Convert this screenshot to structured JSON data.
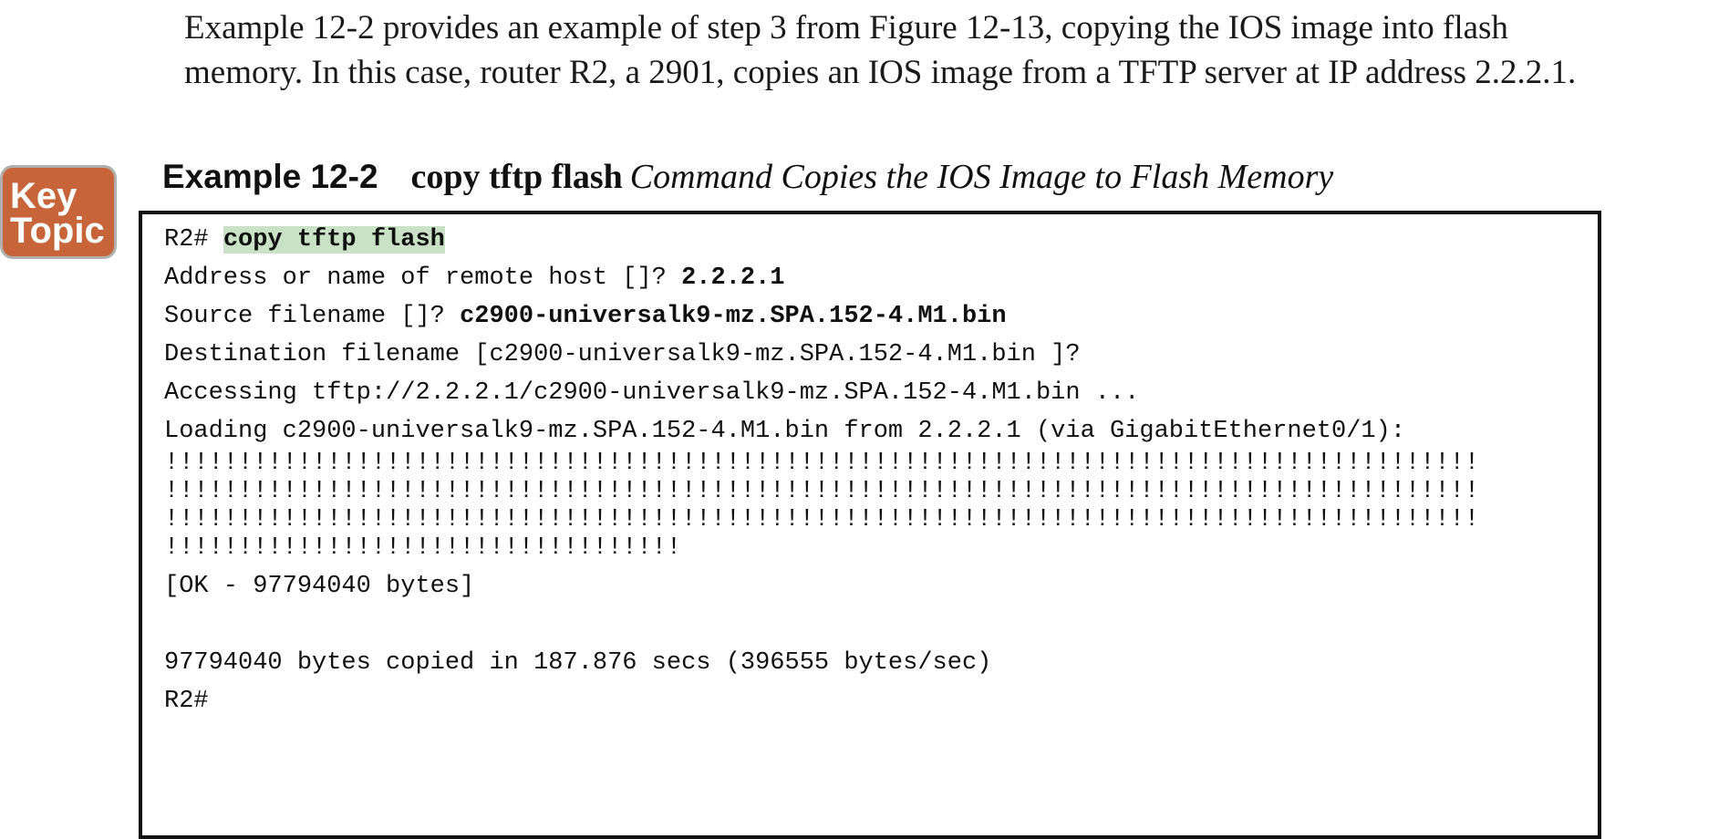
{
  "intro": {
    "text": "Example 12-2 provides an example of step 3 from Figure 12-13, copying the IOS image into flash memory. In this case, router R2, a 2901, copies an IOS image from a TFTP server at IP address 2.2.2.1."
  },
  "key_topic": {
    "line1": "Key",
    "line2": "Topic",
    "color": "#c8643a"
  },
  "example": {
    "label": "Example 12-2",
    "command": "copy tftp flash",
    "description": "Command Copies the IOS Image to Flash Memory"
  },
  "terminal": {
    "line1_prompt": "R2# ",
    "line1_cmd": "copy tftp flash",
    "line2_prompt": "Address or name of remote host []? ",
    "line2_value": "2.2.2.1",
    "line3_prompt": "Source filename []? ",
    "line3_value": "c2900-universalk9-mz.SPA.152-4.M1.bin",
    "line4": "Destination filename [c2900-universalk9-mz.SPA.152-4.M1.bin ]?",
    "line5": "Accessing tftp://2.2.2.1/c2900-universalk9-mz.SPA.152-4.M1.bin ...",
    "line6": "Loading c2900-universalk9-mz.SPA.152-4.M1.bin from 2.2.2.1 (via GigabitEthernet0/1):",
    "bang1": "!!!!!!!!!!!!!!!!!!!!!!!!!!!!!!!!!!!!!!!!!!!!!!!!!!!!!!!!!!!!!!!!!!!!!!!!!!!!!!!!!!!!!!!!!",
    "bang2": "!!!!!!!!!!!!!!!!!!!!!!!!!!!!!!!!!!!!!!!!!!!!!!!!!!!!!!!!!!!!!!!!!!!!!!!!!!!!!!!!!!!!!!!!!",
    "bang3": "!!!!!!!!!!!!!!!!!!!!!!!!!!!!!!!!!!!!!!!!!!!!!!!!!!!!!!!!!!!!!!!!!!!!!!!!!!!!!!!!!!!!!!!!!",
    "bang4": "!!!!!!!!!!!!!!!!!!!!!!!!!!!!!!!!!!!",
    "line_ok": "[OK - 97794040 bytes]",
    "line_copied": "97794040 bytes copied in 187.876 secs (396555 bytes/sec)",
    "line_final": "R2#",
    "highlight_color": "#c9e2c5"
  }
}
